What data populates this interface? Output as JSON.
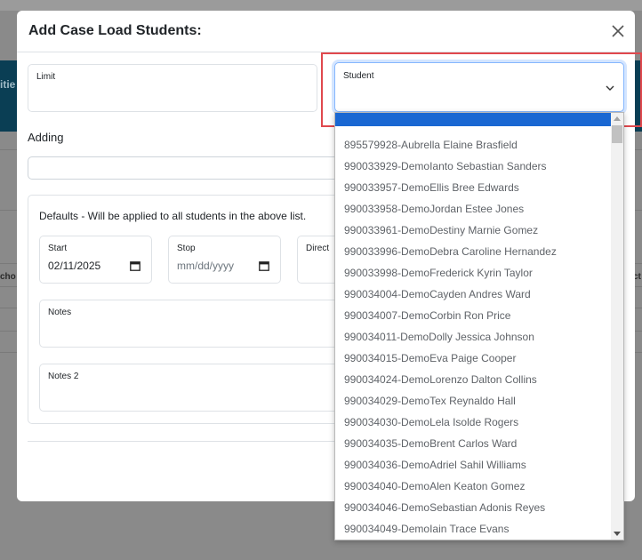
{
  "background": {
    "teal_fragment": "itie",
    "col_fragment_left": "cho",
    "col_fragment_right": "ct"
  },
  "modal": {
    "title": "Add Case Load Students:",
    "limit_label": "Limit",
    "limit_value": "",
    "student_label": "Student",
    "adding_label": "Adding",
    "adding_value": ""
  },
  "defaults": {
    "title": "Defaults - Will be applied to all students in the above list.",
    "start_label": "Start",
    "start_value": "02/11/2025",
    "stop_label": "Stop",
    "stop_placeholder": "mm/dd/yyyy",
    "direct_label": "Direct",
    "notes_label": "Notes",
    "notes2_label": "Notes 2"
  },
  "student_options": [
    "895579928-Aubrella Elaine Brasfield",
    "990033929-DemoIanto Sebastian Sanders",
    "990033957-DemoEllis Bree Edwards",
    "990033958-DemoJordan Estee Jones",
    "990033961-DemoDestiny Marnie Gomez",
    "990033996-DemoDebra Caroline Hernandez",
    "990033998-DemoFrederick Kyrin Taylor",
    "990034004-DemoCayden Andres Ward",
    "990034007-DemoCorbin Ron Price",
    "990034011-DemoDolly Jessica Johnson",
    "990034015-DemoEva Paige Cooper",
    "990034024-DemoLorenzo Dalton Collins",
    "990034029-DemoTex Reynaldo Hall",
    "990034030-DemoLela Isolde Rogers",
    "990034035-DemoBrent Carlos Ward",
    "990034036-DemoAdriel Sahil Williams",
    "990034040-DemoAlen Keaton Gomez",
    "990034046-DemoSebastian Adonis Reyes",
    "990034049-DemoIain Trace Evans"
  ],
  "colors": {
    "highlight_outline": "#e0484d",
    "selected_option": "#1967d2",
    "backdrop": "#8a8a8a"
  },
  "icons": {
    "close": "close-icon",
    "chevron": "chevron-down-icon",
    "calendar": "calendar-icon"
  }
}
